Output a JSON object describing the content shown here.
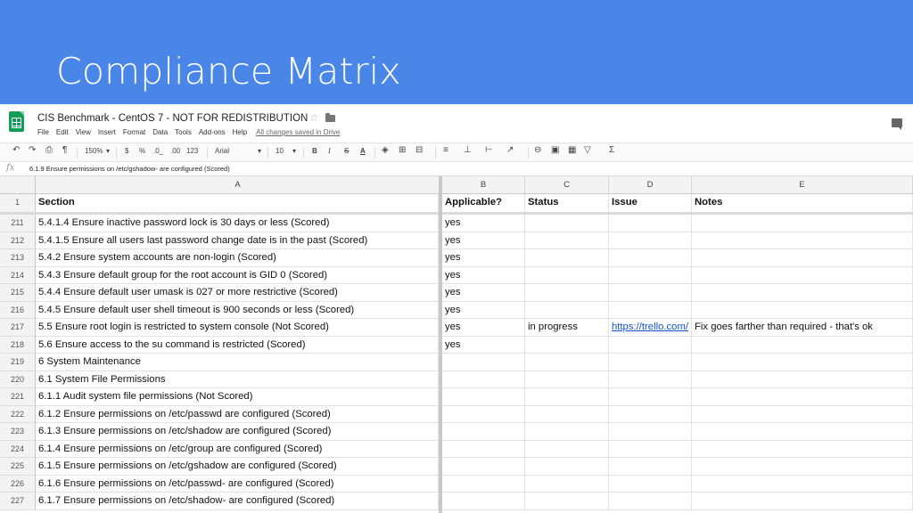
{
  "slide": {
    "title": "Compliance Matrix"
  },
  "app": {
    "doc_title": "CIS Benchmark - CentOS 7 - NOT FOR REDISTRIBUTION",
    "menu": [
      "File",
      "Edit",
      "View",
      "Insert",
      "Format",
      "Data",
      "Tools",
      "Add-ons",
      "Help"
    ],
    "save_status": "All changes saved in Drive"
  },
  "toolbar": {
    "zoom": "150%",
    "currency": "$",
    "percent": "%",
    "decrease_decimals": ".0_",
    "increase_decimals": ".00",
    "more_formats": "123",
    "font": "Arial",
    "font_size": "10",
    "bold": "B",
    "italic": "I",
    "strike": "S",
    "text_color": "A",
    "functions": "Σ",
    "icons": [
      "undo-icon",
      "redo-icon",
      "print-icon",
      "paint-format-icon",
      "fill-color-icon",
      "borders-icon",
      "merge-icon",
      "align-icon",
      "valign-icon",
      "wrap-icon",
      "rotate-icon",
      "link-icon",
      "comment-icon",
      "chart-icon",
      "filter-icon",
      "functions-icon"
    ]
  },
  "formula_bar": {
    "fx": "fx",
    "value": "6.1.9 Ensure permissions on /etc/gshadow- are configured (Scored)"
  },
  "columns": [
    "A",
    "B",
    "C",
    "D",
    "E"
  ],
  "header": {
    "num": "1",
    "cells": [
      "Section",
      "Applicable?",
      "Status",
      "Issue",
      "Notes"
    ]
  },
  "rows": [
    {
      "num": "211",
      "cells": [
        "5.4.1.4 Ensure inactive password lock is 30 days or less (Scored)",
        "yes",
        "",
        "",
        ""
      ]
    },
    {
      "num": "212",
      "cells": [
        "5.4.1.5 Ensure all users last password change date is in the past (Scored)",
        "yes",
        "",
        "",
        ""
      ]
    },
    {
      "num": "213",
      "cells": [
        "5.4.2 Ensure system accounts are non-login (Scored)",
        "yes",
        "",
        "",
        ""
      ]
    },
    {
      "num": "214",
      "cells": [
        "5.4.3 Ensure default group for the root account is GID 0 (Scored)",
        "yes",
        "",
        "",
        ""
      ]
    },
    {
      "num": "215",
      "cells": [
        "5.4.4 Ensure default user umask is 027 or more restrictive (Scored)",
        "yes",
        "",
        "",
        ""
      ]
    },
    {
      "num": "216",
      "cells": [
        "5.4.5 Ensure default user shell timeout is 900 seconds or less (Scored)",
        "yes",
        "",
        "",
        ""
      ]
    },
    {
      "num": "217",
      "cells": [
        "5.5 Ensure root login is restricted to system console (Not Scored)",
        "yes",
        "in progress",
        "https://trello.com/",
        "Fix goes farther than required - that's ok"
      ]
    },
    {
      "num": "218",
      "cells": [
        "5.6 Ensure access to the su command is restricted (Scored)",
        "yes",
        "",
        "",
        ""
      ]
    },
    {
      "num": "219",
      "cells": [
        "6 System Maintenance",
        "",
        "",
        "",
        ""
      ]
    },
    {
      "num": "220",
      "cells": [
        "6.1 System File Permissions",
        "",
        "",
        "",
        ""
      ]
    },
    {
      "num": "221",
      "cells": [
        "6.1.1 Audit system file permissions (Not Scored)",
        "",
        "",
        "",
        ""
      ]
    },
    {
      "num": "222",
      "cells": [
        "6.1.2 Ensure permissions on /etc/passwd are configured (Scored)",
        "",
        "",
        "",
        ""
      ]
    },
    {
      "num": "223",
      "cells": [
        "6.1.3 Ensure permissions on /etc/shadow are configured (Scored)",
        "",
        "",
        "",
        ""
      ]
    },
    {
      "num": "224",
      "cells": [
        "6.1.4 Ensure permissions on /etc/group are configured (Scored)",
        "",
        "",
        "",
        ""
      ]
    },
    {
      "num": "225",
      "cells": [
        "6.1.5 Ensure permissions on /etc/gshadow are configured (Scored)",
        "",
        "",
        "",
        ""
      ]
    },
    {
      "num": "226",
      "cells": [
        "6.1.6 Ensure permissions on /etc/passwd- are configured (Scored)",
        "",
        "",
        "",
        ""
      ]
    },
    {
      "num": "227",
      "cells": [
        "6.1.7 Ensure permissions on /etc/shadow- are configured (Scored)",
        "",
        "",
        "",
        ""
      ]
    }
  ],
  "colors": {
    "banner": "#4a86e8",
    "sheets_green": "#0f9d58",
    "link": "#1155cc"
  }
}
